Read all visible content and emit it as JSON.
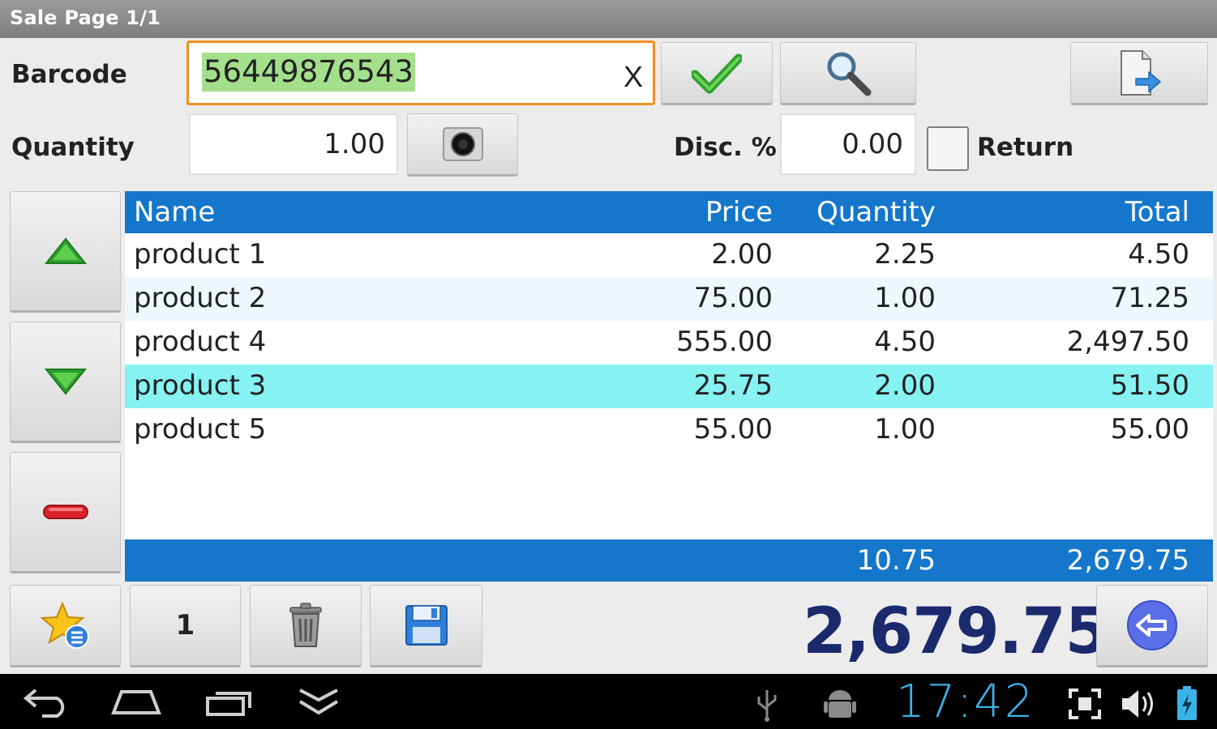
{
  "title": "Sale Page 1/1",
  "labels": {
    "barcode": "Barcode",
    "quantity": "Quantity",
    "discount": "Disc. %",
    "return": "Return"
  },
  "barcode": {
    "value": "56449876543",
    "clear": "X"
  },
  "quantity": {
    "value": "1.00"
  },
  "discount": {
    "value": "0.00"
  },
  "return_checked": false,
  "table": {
    "headers": {
      "name": "Name",
      "price": "Price",
      "quantity": "Quantity",
      "total": "Total"
    },
    "rows": [
      {
        "name": "product 1",
        "price": "2.00",
        "quantity": "2.25",
        "total": "4.50"
      },
      {
        "name": "product 2",
        "price": "75.00",
        "quantity": "1.00",
        "total": "71.25"
      },
      {
        "name": "product 4",
        "price": "555.00",
        "quantity": "4.50",
        "total": "2,497.50"
      },
      {
        "name": "product 3",
        "price": "25.75",
        "quantity": "2.00",
        "total": "51.50"
      },
      {
        "name": "product 5",
        "price": "55.00",
        "quantity": "1.00",
        "total": "55.00"
      }
    ],
    "footer": {
      "quantity": "10.75",
      "total": "2,679.75"
    }
  },
  "bottom": {
    "page_button": "1",
    "grand_total": "2,679.75"
  },
  "status": {
    "clock": "17:42"
  },
  "colors": {
    "accent": "#1577cb",
    "selected_row": "#86f2f2",
    "barcode_focus": "#f0901e",
    "barcode_highlight": "#a4e08c",
    "grand_total": "#1a2a6c",
    "clock": "#3bb2e6"
  },
  "icons": {
    "confirm": "checkmark-icon",
    "search": "search-icon",
    "export": "document-export-icon",
    "camera": "camera-icon",
    "up": "arrow-up-icon",
    "down": "arrow-down-icon",
    "remove": "minus-icon",
    "favorites": "star-list-icon",
    "delete": "trash-icon",
    "save": "save-icon",
    "back": "back-arrow-icon"
  }
}
